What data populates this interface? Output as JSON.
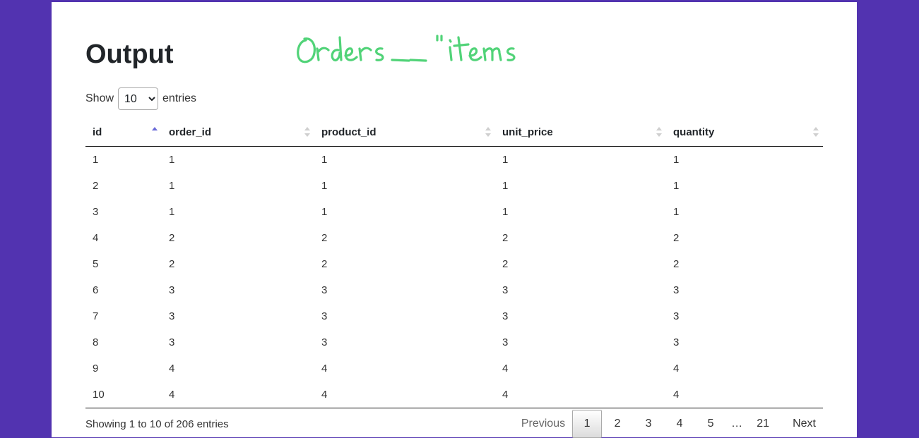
{
  "heading": "Output",
  "annotation": "orders_items",
  "length_menu": {
    "prefix": "Show",
    "selected": "10",
    "suffix": "entries"
  },
  "table": {
    "columns": [
      "id",
      "order_id",
      "product_id",
      "unit_price",
      "quantity"
    ],
    "sorted_column": "id",
    "sort_direction": "ascending",
    "rows": [
      [
        "1",
        "1",
        "1",
        "1",
        "1"
      ],
      [
        "2",
        "1",
        "1",
        "1",
        "1"
      ],
      [
        "3",
        "1",
        "1",
        "1",
        "1"
      ],
      [
        "4",
        "2",
        "2",
        "2",
        "2"
      ],
      [
        "5",
        "2",
        "2",
        "2",
        "2"
      ],
      [
        "6",
        "3",
        "3",
        "3",
        "3"
      ],
      [
        "7",
        "3",
        "3",
        "3",
        "3"
      ],
      [
        "8",
        "3",
        "3",
        "3",
        "3"
      ],
      [
        "9",
        "4",
        "4",
        "4",
        "4"
      ],
      [
        "10",
        "4",
        "4",
        "4",
        "4"
      ]
    ]
  },
  "info_text": "Showing 1 to 10 of 206 entries",
  "pagination": {
    "previous": "Previous",
    "pages": [
      "1",
      "2",
      "3",
      "4",
      "5"
    ],
    "current": "1",
    "ellipsis": "…",
    "last": "21",
    "next": "Next"
  },
  "colors": {
    "background": "#5233b0",
    "panel": "#ffffff",
    "annotation_ink": "#3fcf6a",
    "sort_active": "#6a6ad8"
  }
}
